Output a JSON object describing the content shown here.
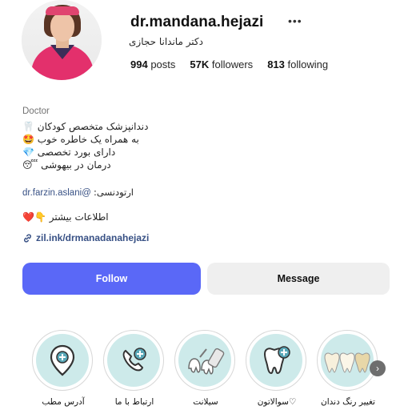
{
  "profile": {
    "username": "dr.mandana.hejazi",
    "full_name": "دکتر ماندانا حجازی",
    "stats": [
      {
        "value": "994",
        "label": "posts"
      },
      {
        "value": "57K",
        "label": "followers"
      },
      {
        "value": "813",
        "label": "following"
      }
    ],
    "category": "Doctor",
    "bio": [
      {
        "text": "دندانپزشک متخصص کودکان",
        "emoji": "🦷"
      },
      {
        "text": "به همراه یک خاطره خوب",
        "emoji": "🤩"
      },
      {
        "text": "دارای بورد تخصصی",
        "emoji": "💎"
      },
      {
        "text": "درمان در بیهوشی",
        "emoji": "😴"
      }
    ],
    "tag_label": "ارتودنسی:",
    "tag_handle": "dr.farzin.aslani@",
    "more_info": "اطلاعات بیشتر",
    "more_info_emoji": "❤️👇",
    "link": "zil.ink/drmanadanahejazi"
  },
  "buttons": {
    "follow": "Follow",
    "message": "Message"
  },
  "highlights": [
    {
      "label": "آدرس مطب",
      "icon": "location-pin-icon"
    },
    {
      "label": "ارتباط با ما",
      "icon": "phone-icon"
    },
    {
      "label": "سیلانت",
      "icon": "dental-tools-icon"
    },
    {
      "label": "سوالاتون♡",
      "icon": "tooth-question-icon"
    },
    {
      "label": "تغییر رنگ دندان",
      "icon": "teeth-shades-icon"
    }
  ],
  "colors": {
    "follow_bg": "#5a68f7",
    "link": "#385185",
    "highlight_bg": "#cdeaea"
  }
}
